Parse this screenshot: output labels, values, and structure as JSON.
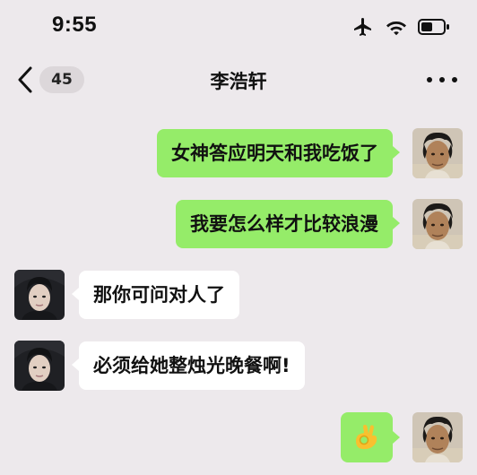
{
  "status_bar": {
    "time": "9:55",
    "icons": [
      "airplane-icon",
      "wifi-icon",
      "battery-icon"
    ]
  },
  "nav": {
    "back_icon": "chevron-left-icon",
    "unread_count": "45",
    "title": "李浩轩",
    "more_icon": "ellipsis-icon"
  },
  "messages": [
    {
      "side": "sent",
      "text": "女神答应明天和我吃饭了"
    },
    {
      "side": "sent",
      "text": "我要怎么样才比较浪漫"
    },
    {
      "side": "received",
      "text": "那你可问对人了"
    },
    {
      "side": "received",
      "text": "必须给她整烛光晚餐啊!"
    },
    {
      "side": "sent",
      "emoji": "ok-hand-emoji"
    }
  ],
  "colors": {
    "background": "#ede9ec",
    "sent_bubble": "#95ec69",
    "received_bubble": "#ffffff"
  }
}
